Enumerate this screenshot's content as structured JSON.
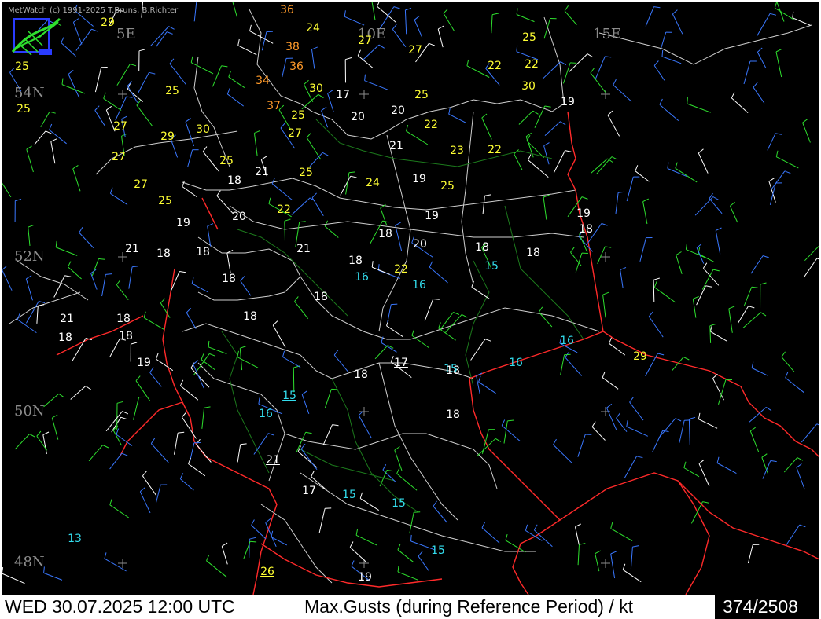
{
  "header": {
    "copyright": "MetWatch  (c) 1991-2025 T.Bruns, B.Richter",
    "logo_icon": "metwatch-logo-icon"
  },
  "coordinates": {
    "lon": [
      "5E",
      "10E",
      "15E"
    ],
    "lat": [
      "54N",
      "52N",
      "50N",
      "48N"
    ]
  },
  "colors": {
    "background": "#000000",
    "border_line": "#d9d9d9",
    "country_border": "#ff2a2a",
    "river": "#1c7a1c",
    "level_white": "#ffffff",
    "level_cyan": "#33ddee",
    "level_yellow": "#ffff33",
    "level_orange": "#ff9a2a",
    "barb_blue": "#3a78ff",
    "barb_green": "#2ee02e",
    "barb_white": "#ffffff"
  },
  "gusts": [
    {
      "v": "36",
      "c": "o"
    },
    {
      "v": "24",
      "c": "y"
    },
    {
      "v": "29",
      "c": "y"
    },
    {
      "v": "27",
      "c": "y"
    },
    {
      "v": "27",
      "c": "y"
    },
    {
      "v": "25",
      "c": "y"
    },
    {
      "v": "38",
      "c": "o"
    },
    {
      "v": "36",
      "c": "o"
    },
    {
      "v": "22",
      "c": "y"
    },
    {
      "v": "22",
      "c": "y"
    },
    {
      "v": "25",
      "c": "y"
    },
    {
      "v": "34",
      "c": "o"
    },
    {
      "v": "25",
      "c": "y"
    },
    {
      "v": "30",
      "c": "y"
    },
    {
      "v": "17",
      "c": "w"
    },
    {
      "v": "30",
      "c": "y"
    },
    {
      "v": "25",
      "c": "y"
    },
    {
      "v": "19",
      "c": "w"
    },
    {
      "v": "25",
      "c": "y"
    },
    {
      "v": "37",
      "c": "o"
    },
    {
      "v": "20",
      "c": "w"
    },
    {
      "v": "25",
      "c": "y"
    },
    {
      "v": "20",
      "c": "w"
    },
    {
      "v": "22",
      "c": "y"
    },
    {
      "v": "27",
      "c": "y"
    },
    {
      "v": "30",
      "c": "y"
    },
    {
      "v": "27",
      "c": "y"
    },
    {
      "v": "29",
      "c": "y"
    },
    {
      "v": "21",
      "c": "w"
    },
    {
      "v": "23",
      "c": "y"
    },
    {
      "v": "22",
      "c": "y"
    },
    {
      "v": "27",
      "c": "y"
    },
    {
      "v": "25",
      "c": "y"
    },
    {
      "v": "21",
      "c": "w"
    },
    {
      "v": "25",
      "c": "y"
    },
    {
      "v": "19",
      "c": "w"
    },
    {
      "v": "18",
      "c": "w"
    },
    {
      "v": "27",
      "c": "y"
    },
    {
      "v": "25",
      "c": "y"
    },
    {
      "v": "24",
      "c": "y"
    },
    {
      "v": "25",
      "c": "y"
    },
    {
      "v": "22",
      "c": "y"
    },
    {
      "v": "20",
      "c": "w"
    },
    {
      "v": "19",
      "c": "w"
    },
    {
      "v": "19",
      "c": "w"
    },
    {
      "v": "19",
      "c": "w"
    },
    {
      "v": "18",
      "c": "w"
    },
    {
      "v": "18",
      "c": "w"
    },
    {
      "v": "20",
      "c": "w"
    },
    {
      "v": "21",
      "c": "w"
    },
    {
      "v": "18",
      "c": "w"
    },
    {
      "v": "18",
      "c": "w"
    },
    {
      "v": "21",
      "c": "w"
    },
    {
      "v": "18",
      "c": "w"
    },
    {
      "v": "18",
      "c": "w"
    },
    {
      "v": "18",
      "c": "w"
    },
    {
      "v": "15",
      "c": "c"
    },
    {
      "v": "16",
      "c": "c"
    },
    {
      "v": "18",
      "c": "w"
    },
    {
      "v": "22",
      "c": "y"
    },
    {
      "v": "18",
      "c": "w"
    },
    {
      "v": "16",
      "c": "c"
    },
    {
      "v": "18",
      "c": "w"
    },
    {
      "v": "21",
      "c": "w"
    },
    {
      "v": "18",
      "c": "w"
    },
    {
      "v": "18",
      "c": "w"
    },
    {
      "v": "18",
      "c": "w"
    },
    {
      "v": "19",
      "c": "w"
    },
    {
      "v": "16",
      "c": "c"
    },
    {
      "v": "29",
      "c": "y",
      "u": true
    },
    {
      "v": "18",
      "c": "w"
    },
    {
      "v": "16",
      "c": "c"
    },
    {
      "v": "17",
      "c": "w",
      "u": true
    },
    {
      "v": "18",
      "c": "w",
      "u": true
    },
    {
      "v": "15",
      "c": "c"
    },
    {
      "v": "15",
      "c": "c",
      "u": true
    },
    {
      "v": "16",
      "c": "c"
    },
    {
      "v": "18",
      "c": "w"
    },
    {
      "v": "21",
      "c": "w",
      "u": true
    },
    {
      "v": "17",
      "c": "w"
    },
    {
      "v": "15",
      "c": "c"
    },
    {
      "v": "15",
      "c": "c"
    },
    {
      "v": "13",
      "c": "c"
    },
    {
      "v": "15",
      "c": "c"
    },
    {
      "v": "26",
      "c": "y",
      "u": true
    },
    {
      "v": "19",
      "c": "w"
    }
  ],
  "footer": {
    "datetime": "WED 30.07.2025 12:00 UTC",
    "parameter": "Max.Gusts (during Reference Period) / kt",
    "station_count": "374/2508"
  }
}
